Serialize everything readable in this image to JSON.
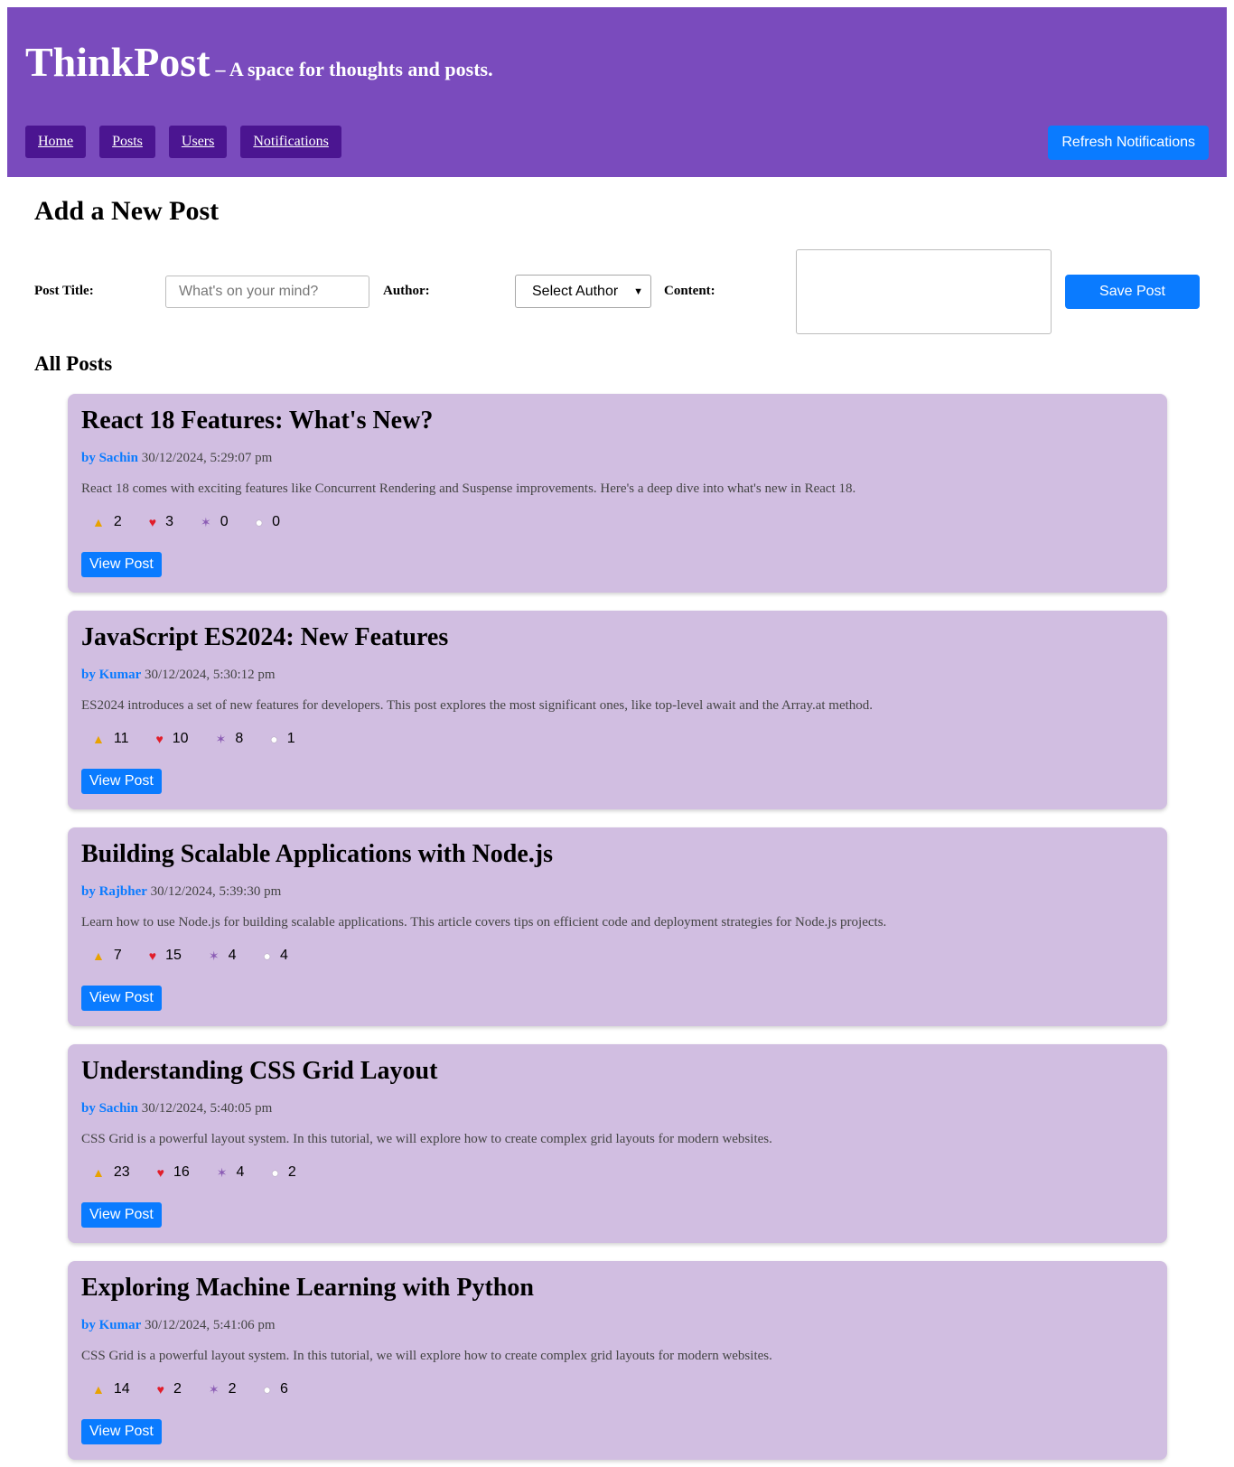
{
  "header": {
    "title": "ThinkPost",
    "tagline": "– A space for thoughts and posts.",
    "background": "#7a4bbd",
    "nav": [
      {
        "label": "Home"
      },
      {
        "label": "Posts"
      },
      {
        "label": "Users"
      },
      {
        "label": "Notifications"
      }
    ],
    "refresh_label": "Refresh Notifications"
  },
  "form": {
    "heading": "Add a New Post",
    "title_label": "Post Title:",
    "title_placeholder": "What's on your mind?",
    "title_value": "",
    "author_label": "Author:",
    "author_selected": "Select Author",
    "content_label": "Content:",
    "content_value": "",
    "save_label": "Save Post"
  },
  "posts_section": {
    "heading": "All Posts"
  },
  "icons": {
    "thumbs": "thumbs-up-icon",
    "heart": "heart-icon",
    "tada": "party-popper-icon",
    "comment": "speech-bubble-icon"
  },
  "posts": [
    {
      "title": "React 18 Features: What's New?",
      "author": "by Sachin",
      "date": "30/12/2024, 5:29:07 pm",
      "body": "React 18 comes with exciting features like Concurrent Rendering and Suspense improvements. Here's a deep dive into what's new in React 18.",
      "reactions": {
        "thumbs": "2",
        "heart": "3",
        "tada": "0",
        "comment": "0"
      },
      "view_label": "View Post"
    },
    {
      "title": "JavaScript ES2024: New Features",
      "author": "by Kumar",
      "date": "30/12/2024, 5:30:12 pm",
      "body": "ES2024 introduces a set of new features for developers. This post explores the most significant ones, like top-level await and the Array.at method.",
      "reactions": {
        "thumbs": "11",
        "heart": "10",
        "tada": "8",
        "comment": "1"
      },
      "view_label": "View Post"
    },
    {
      "title": "Building Scalable Applications with Node.js",
      "author": "by Rajbher",
      "date": "30/12/2024, 5:39:30 pm",
      "body": "Learn how to use Node.js for building scalable applications. This article covers tips on efficient code and deployment strategies for Node.js projects.",
      "reactions": {
        "thumbs": "7",
        "heart": "15",
        "tada": "4",
        "comment": "4"
      },
      "view_label": "View Post"
    },
    {
      "title": "Understanding CSS Grid Layout",
      "author": "by Sachin",
      "date": "30/12/2024, 5:40:05 pm",
      "body": "CSS Grid is a powerful layout system. In this tutorial, we will explore how to create complex grid layouts for modern websites.",
      "reactions": {
        "thumbs": "23",
        "heart": "16",
        "tada": "4",
        "comment": "2"
      },
      "view_label": "View Post"
    },
    {
      "title": "Exploring Machine Learning with Python",
      "author": "by Kumar",
      "date": "30/12/2024, 5:41:06 pm",
      "body": "CSS Grid is a powerful layout system. In this tutorial, we will explore how to create complex grid layouts for modern websites.",
      "reactions": {
        "thumbs": "14",
        "heart": "2",
        "tada": "2",
        "comment": "6"
      },
      "view_label": "View Post"
    }
  ]
}
